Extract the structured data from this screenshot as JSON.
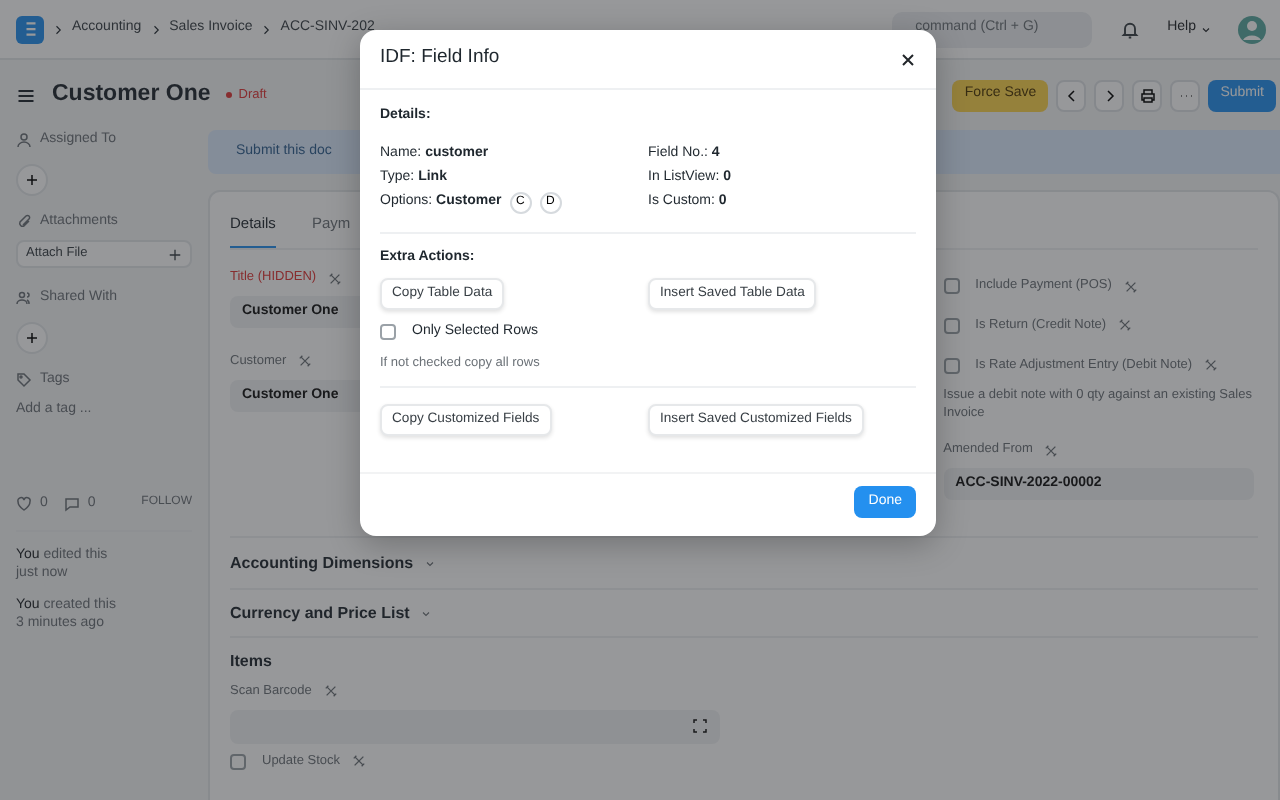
{
  "navbar": {
    "breadcrumbs": [
      "Accounting",
      "Sales Invoice",
      "ACC-SINV-202"
    ],
    "search_text": "command (Ctrl + G)",
    "help": "Help"
  },
  "page_head": {
    "title": "Customer One",
    "status": "Draft",
    "buttons": [
      {
        "label": "Force Save",
        "kind": "warning"
      },
      {
        "label": "Submit",
        "kind": "primary"
      }
    ]
  },
  "sidebar": {
    "assigned_to": "Assigned To",
    "attachments": "Attachments",
    "attach_file": "Attach File",
    "shared_with": "Shared With",
    "tags": "Tags",
    "add_tag": "Add a tag ...",
    "likes": "0",
    "comments": "0",
    "follow": "FOLLOW",
    "timeline": [
      {
        "actor": "You",
        "text": "edited this",
        "time": "just now"
      },
      {
        "actor": "You",
        "text": "created this",
        "time": "3 minutes ago"
      }
    ]
  },
  "alert": "Submit this doc",
  "tabs": [
    {
      "label": "Details",
      "selected": true
    },
    {
      "label": "Paym",
      "selected": false
    }
  ],
  "left_fields": [
    {
      "label": "Title (HIDDEN)",
      "hidden": true,
      "value": "Customer One"
    },
    {
      "label": "Customer",
      "hidden": false,
      "value": "Customer One"
    }
  ],
  "right_checks": [
    {
      "label": "Include Payment (POS)",
      "checked": false
    },
    {
      "label": "Is Return (Credit Note)",
      "checked": false
    },
    {
      "label": "Is Rate Adjustment Entry (Debit Note)",
      "checked": false
    }
  ],
  "right_description": "Issue a debit note with 0 qty against an existing Sales Invoice",
  "amended_from": {
    "label": "Amended From",
    "value": "ACC-SINV-2022-00002"
  },
  "sections": [
    {
      "title": "Accounting Dimensions",
      "collapsible": true
    },
    {
      "title": "Currency and Price List",
      "collapsible": true
    },
    {
      "title": "Items",
      "collapsible": false
    }
  ],
  "scan_barcode": {
    "label": "Scan Barcode"
  },
  "update_stock": {
    "label": "Update Stock",
    "checked": false
  },
  "modal": {
    "title": "IDF: Field Info",
    "details_heading": "Details:",
    "details_left": [
      {
        "label": "Name:",
        "value": "customer"
      },
      {
        "label": "Type:",
        "value": "Link"
      },
      {
        "label": "Options:",
        "value": "Customer",
        "chips": [
          "C",
          "D"
        ]
      }
    ],
    "details_right": [
      {
        "label": "Field No.:",
        "value": "4"
      },
      {
        "label": "In ListView:",
        "value": "0"
      },
      {
        "label": "Is Custom:",
        "value": "0"
      }
    ],
    "extra_heading": "Extra Actions:",
    "table_buttons": [
      "Copy Table Data",
      "Insert Saved Table Data"
    ],
    "only_selected": {
      "label": "Only Selected Rows",
      "checked": false
    },
    "hint": "If not checked copy all rows",
    "custom_buttons": [
      "Copy Customized Fields",
      "Insert Saved Customized Fields"
    ],
    "done": "Done"
  }
}
